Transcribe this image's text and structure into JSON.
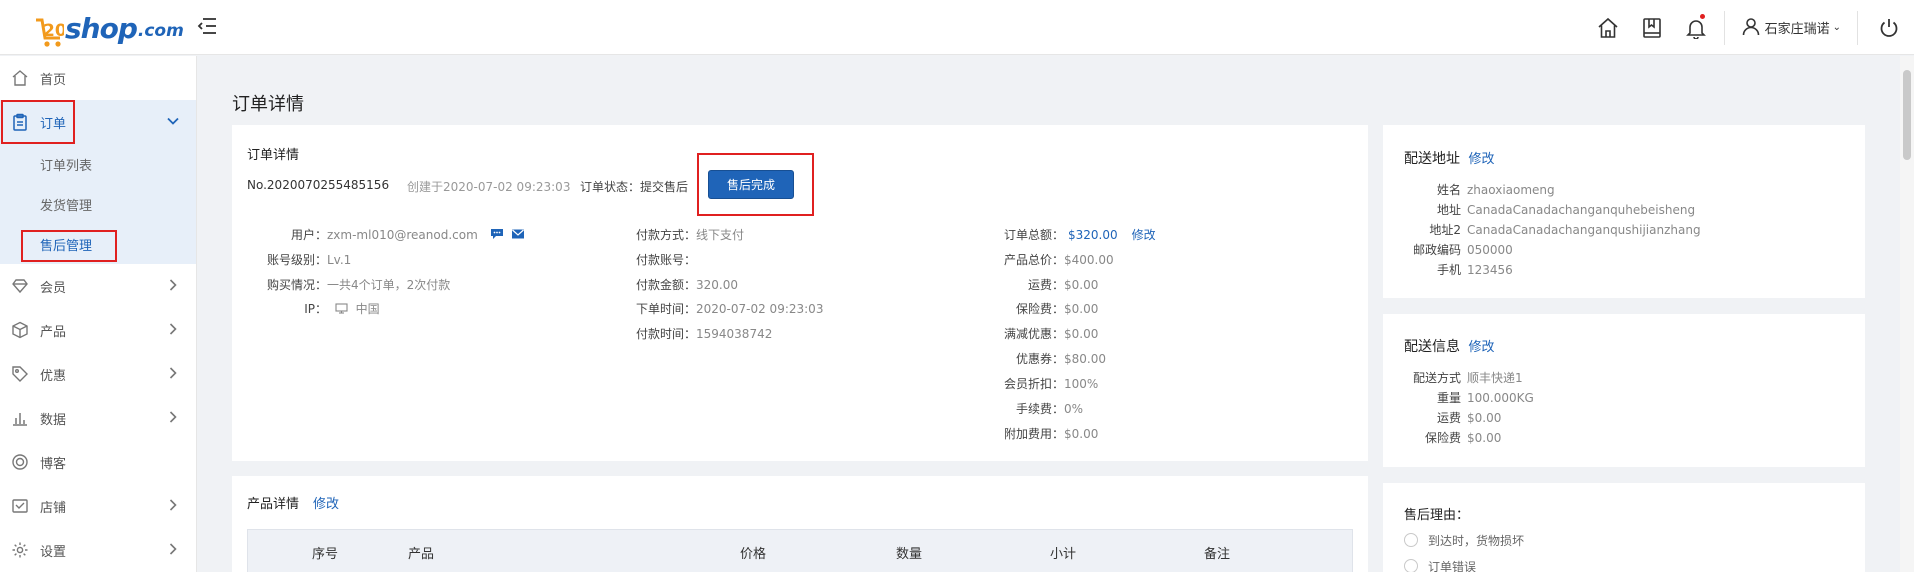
{
  "brand": {
    "logo_number": "20",
    "logo_text": "shop",
    "logo_suffix": ".com"
  },
  "header": {
    "user_name": "石家庄瑞诺",
    "user_caret": "⌄"
  },
  "sidebar": {
    "items": [
      {
        "label": "首页",
        "icon": "home-icon"
      },
      {
        "label": "订单",
        "icon": "clipboard-icon",
        "active": true
      },
      {
        "label": "会员",
        "icon": "diamond-icon"
      },
      {
        "label": "产品",
        "icon": "box-icon"
      },
      {
        "label": "优惠",
        "icon": "tag-icon"
      },
      {
        "label": "数据",
        "icon": "bar-chart-icon"
      },
      {
        "label": "博客",
        "icon": "target-icon"
      },
      {
        "label": "店铺",
        "icon": "shop-icon"
      },
      {
        "label": "设置",
        "icon": "gear-icon"
      }
    ],
    "order_sub": [
      {
        "label": "订单列表"
      },
      {
        "label": "发货管理"
      },
      {
        "label": "售后管理",
        "active": true
      }
    ]
  },
  "page_title": "订单详情",
  "order": {
    "section_title": "订单详情",
    "order_no": "No.2020070255485156",
    "created": "创建于2020-07-02 09:23:03",
    "status_label": "订单状态：",
    "status_value": "提交售后",
    "after_sale_button": "售后完成",
    "user_label": "用户：",
    "user_value": "zxm-ml010@reanod.com",
    "level_label": "账号级别：",
    "level_value": "Lv.1",
    "purchase_label": "购买情况：",
    "purchase_value": "一共4个订单，2次付款",
    "ip_label": "IP：",
    "ip_value": "中国",
    "pay_method_label": "付款方式：",
    "pay_method_value": "线下支付",
    "pay_account_label": "付款账号：",
    "pay_account_value": "",
    "pay_amount_label": "付款金额：",
    "pay_amount_value": "320.00",
    "order_time_label": "下单时间：",
    "order_time_value": "2020-07-02 09:23:03",
    "pay_time_label": "付款时间：",
    "pay_time_value": "1594038742",
    "total_label": "订单总额：",
    "total_value": "$320.00",
    "total_edit": "修改",
    "product_total_label": "产品总价：",
    "product_total_value": "$400.00",
    "shipping_label": "运费：",
    "shipping_value": "$0.00",
    "insurance_label": "保险费：",
    "insurance_value": "$0.00",
    "discount_label": "满减优惠：",
    "discount_value": "$0.00",
    "coupon_label": "优惠券：",
    "coupon_value": "$80.00",
    "member_discount_label": "会员折扣：",
    "member_discount_value": "100%",
    "fee_label": "手续费：",
    "fee_value": "0%",
    "extra_label": "附加费用：",
    "extra_value": "$0.00"
  },
  "products": {
    "title": "产品详情",
    "edit": "修改",
    "columns": [
      "序号",
      "产品",
      "价格",
      "数量",
      "小计",
      "备注"
    ]
  },
  "address": {
    "title": "配送地址",
    "edit": "修改",
    "rows": [
      {
        "k": "姓名",
        "v": "zhaoxiaomeng"
      },
      {
        "k": "地址",
        "v": "CanadaCanadachanganquhebeisheng"
      },
      {
        "k": "地址2",
        "v": "CanadaCanadachanganqushijianzhang"
      },
      {
        "k": "邮政编码",
        "v": "050000"
      },
      {
        "k": "手机",
        "v": "123456"
      }
    ]
  },
  "shipping": {
    "title": "配送信息",
    "edit": "修改",
    "rows": [
      {
        "k": "配送方式",
        "v": "顺丰快递1"
      },
      {
        "k": "重量",
        "v": "100.000KG"
      },
      {
        "k": "运费",
        "v": "$0.00"
      },
      {
        "k": "保险费",
        "v": "$0.00"
      }
    ]
  },
  "reason": {
    "title": "售后理由：",
    "options": [
      "到达时，货物损坏",
      "订单错误"
    ]
  },
  "colors": {
    "primary": "#1f64b8",
    "highlight": "#e02020",
    "accent_orange": "#f29a1c"
  }
}
